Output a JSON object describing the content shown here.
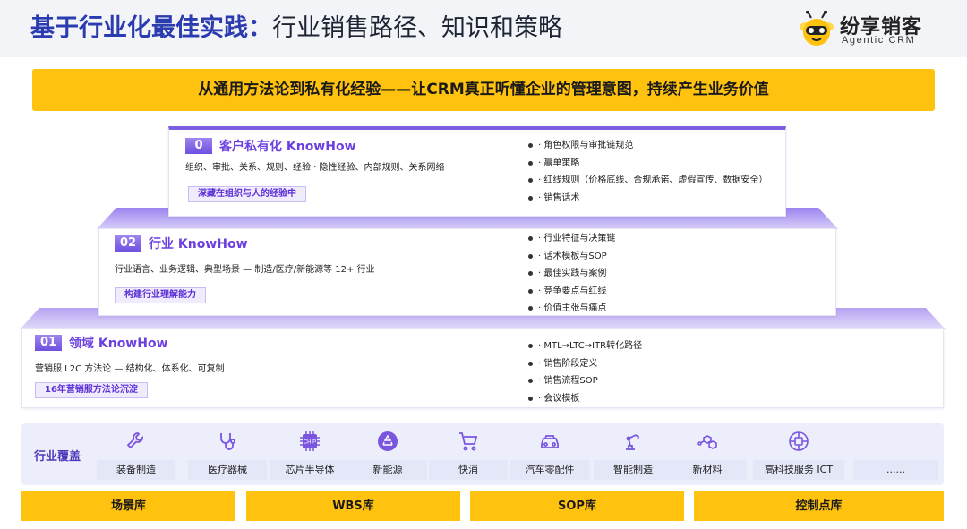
{
  "header": {
    "title_bold": "基于行业化最佳实践：",
    "title_rest": "行业销售路径、知识和策略",
    "logo_name": "纷享销客",
    "logo_sub": "Agentic CRM",
    "logo_icon": "bee-mascot-icon"
  },
  "banner": "从通用方法论到私有化经验——让CRM真正听懂企业的管理意图，持续产生业务价值",
  "levels": [
    {
      "num": "0",
      "title": "客户私有化 KnowHow",
      "desc": "组织、审批、关系、规则、经验 · 隐性经验、内部规则、关系网络",
      "tag": "深藏在组织与人的经验中",
      "bullets": [
        "· 角色权限与审批链规范",
        "· 赢单策略",
        "· 红线规则（价格底线、合规承诺、虚假宣传、数据安全）",
        "· 销售话术"
      ]
    },
    {
      "num": "02",
      "title": "行业 KnowHow",
      "desc": "行业语言、业务逻辑、典型场景 — 制造/医疗/新能源等 12+ 行业",
      "tag": "构建行业理解能力",
      "bullets": [
        "· 行业特征与决策链",
        "· 话术模板与SOP",
        "· 最佳实践与案例",
        "· 竞争要点与红线",
        "· 价值主张与痛点"
      ]
    },
    {
      "num": "01",
      "title": "领域 KnowHow",
      "desc": "营销服 L2C 方法论 — 结构化、体系化、可复制",
      "tag": "16年营销服方法论沉淀",
      "bullets": [
        "· MTL→LTC→ITR转化路径",
        "· 销售阶段定义",
        "· 销售流程SOP",
        "· 会议模板"
      ]
    }
  ],
  "industry": {
    "label": "行业覆盖",
    "items": [
      {
        "name": "装备制造",
        "icon": "wrench-icon"
      },
      {
        "name": "医疗器械",
        "icon": "stethoscope-icon"
      },
      {
        "name": "芯片半导体",
        "icon": "chip-icon",
        "icon_text": "CHIP"
      },
      {
        "name": "新能源",
        "icon": "recycle-icon"
      },
      {
        "name": "快消",
        "icon": "shopping-cart-icon"
      },
      {
        "name": "汽车零配件",
        "icon": "car-icon"
      },
      {
        "name": "智能制造",
        "icon": "robot-arm-icon"
      },
      {
        "name": "新材料",
        "icon": "molecule-icon"
      },
      {
        "name": "高科技服务 ICT",
        "icon": "network-icon"
      },
      {
        "name": "......",
        "icon": ""
      }
    ]
  },
  "libraries": [
    "场景库",
    "WBS库",
    "SOP库",
    "控制点库"
  ],
  "colors": {
    "accent": "#ffc20e",
    "purple": "#6b3fe0",
    "title_blue": "#2b3bb0",
    "strip_bg": "#eceefb"
  }
}
